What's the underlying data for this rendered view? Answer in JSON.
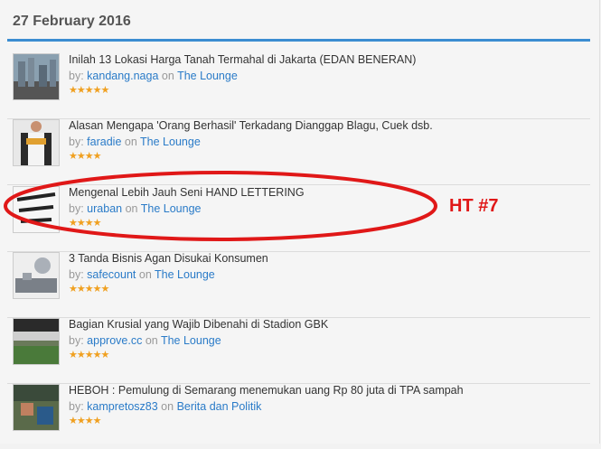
{
  "page": {
    "date": "27 February 2016"
  },
  "labels": {
    "by": "by:",
    "on": "on"
  },
  "items": [
    {
      "title": "Inilah 13 Lokasi Harga Tanah Termahal di Jakarta (EDAN BENERAN)",
      "author": "kandang.naga",
      "forum": "The Lounge",
      "rating": 5,
      "stars": "★★★★★"
    },
    {
      "title": "Alasan Mengapa 'Orang Berhasil' Terkadang Dianggap Blagu, Cuek dsb.",
      "author": "faradie",
      "forum": "The Lounge",
      "rating": 4,
      "stars": "★★★★"
    },
    {
      "title": "Mengenal Lebih Jauh Seni HAND LETTERING",
      "author": "uraban",
      "forum": "The Lounge",
      "rating": 4,
      "stars": "★★★★"
    },
    {
      "title": "3 Tanda Bisnis Agan Disukai Konsumen",
      "author": "safecount",
      "forum": "The Lounge",
      "rating": 5,
      "stars": "★★★★★"
    },
    {
      "title": "Bagian Krusial yang Wajib Dibenahi di Stadion GBK",
      "author": "approve.cc",
      "forum": "The Lounge",
      "rating": 5,
      "stars": "★★★★★"
    },
    {
      "title": "HEBOH : Pemulung di Semarang menemukan uang Rp 80 juta di TPA sampah",
      "author": "kampretosz83",
      "forum": "Berita dan Politik",
      "rating": 4,
      "stars": "★★★★"
    }
  ],
  "annotation": {
    "label": "HT #7",
    "color": "#e01818"
  },
  "colors": {
    "accent": "#3b8dd1",
    "link": "#2a7bc8",
    "star": "#f0a020"
  }
}
